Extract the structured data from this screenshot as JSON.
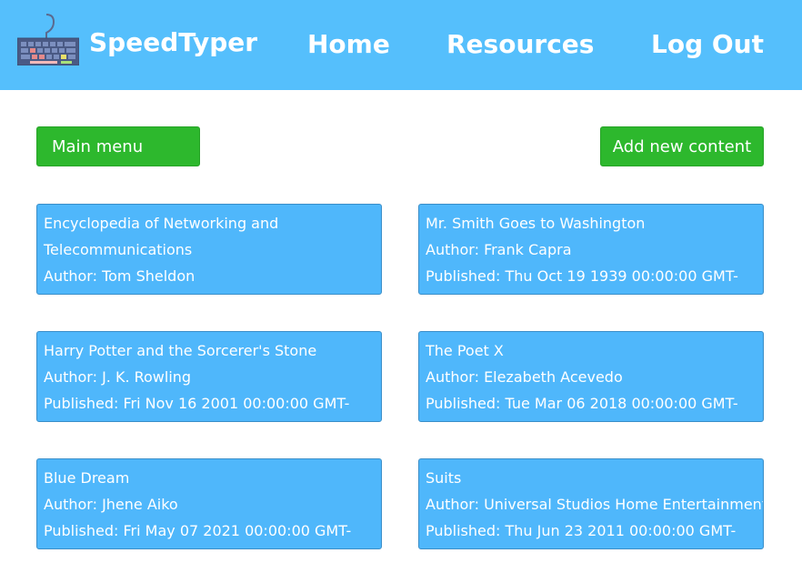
{
  "header": {
    "brand": "SpeedTyper",
    "nav": {
      "home": "Home",
      "resources": "Resources",
      "logout": "Log Out"
    }
  },
  "actions": {
    "main_menu": "Main menu",
    "add_content": "Add new content"
  },
  "cards": [
    {
      "title": "Encyclopedia of Networking and Telecommunications",
      "author": "Author: Tom Sheldon",
      "published": ""
    },
    {
      "title": "Mr. Smith Goes to Washington",
      "author": "Author: Frank Capra",
      "published": "Published: Thu Oct 19 1939 00:00:00 GMT-"
    },
    {
      "title": "Harry Potter and the Sorcerer's Stone",
      "author": "Author: J. K. Rowling",
      "published": "Published: Fri Nov 16 2001 00:00:00 GMT-"
    },
    {
      "title": "The Poet X",
      "author": "Author: Elezabeth Acevedo",
      "published": "Published: Tue Mar 06 2018 00:00:00 GMT-"
    },
    {
      "title": "Blue Dream",
      "author": "Author: Jhene Aiko",
      "published": "Published: Fri May 07 2021 00:00:00 GMT-"
    },
    {
      "title": "Suits",
      "author": "Author: Universal Studios Home Entertainment",
      "published": "Published: Thu Jun 23 2011 00:00:00 GMT-"
    }
  ],
  "colors": {
    "header_bg": "#55bffc",
    "card_bg": "#4fb7fb",
    "button_bg": "#2db82d"
  },
  "icons": {
    "logo": "keyboard-icon"
  }
}
